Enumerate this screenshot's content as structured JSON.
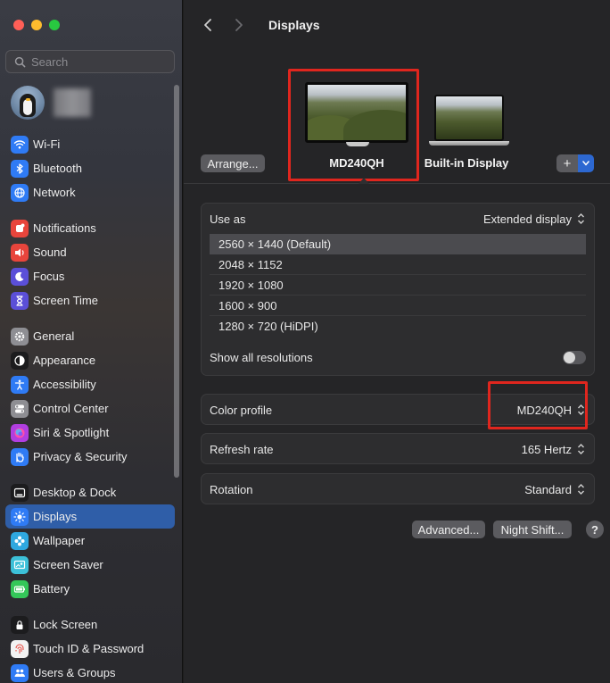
{
  "window": {
    "title": "Displays"
  },
  "sidebar": {
    "search_placeholder": "Search",
    "items": [
      {
        "label": "Wi-Fi",
        "icon": "wifi-icon",
        "color": "#2f7bf5"
      },
      {
        "label": "Bluetooth",
        "icon": "bluetooth-icon",
        "color": "#2f7bf5"
      },
      {
        "label": "Network",
        "icon": "globe-icon",
        "color": "#2f7bf5"
      },
      {
        "label": "Notifications",
        "icon": "bell-icon",
        "color": "#e8453c"
      },
      {
        "label": "Sound",
        "icon": "speaker-icon",
        "color": "#e8453c"
      },
      {
        "label": "Focus",
        "icon": "moon-icon",
        "color": "#5b4fd8"
      },
      {
        "label": "Screen Time",
        "icon": "hourglass-icon",
        "color": "#5b4fd8"
      },
      {
        "label": "General",
        "icon": "gear-icon",
        "color": "#8e8e93"
      },
      {
        "label": "Appearance",
        "icon": "appearance-icon",
        "color": "#1c1c1e"
      },
      {
        "label": "Accessibility",
        "icon": "accessibility-icon",
        "color": "#2f7bf5"
      },
      {
        "label": "Control Center",
        "icon": "switches-icon",
        "color": "#8e8e93"
      },
      {
        "label": "Siri & Spotlight",
        "icon": "siri-icon",
        "color": "#b13ee0"
      },
      {
        "label": "Privacy & Security",
        "icon": "hand-icon",
        "color": "#2f7bf5"
      },
      {
        "label": "Desktop & Dock",
        "icon": "dock-icon",
        "color": "#1c1c1e"
      },
      {
        "label": "Displays",
        "icon": "sun-icon",
        "color": "#2f7bf5"
      },
      {
        "label": "Wallpaper",
        "icon": "flower-icon",
        "color": "#2fa8e0"
      },
      {
        "label": "Screen Saver",
        "icon": "screensaver-icon",
        "color": "#3cc0d8"
      },
      {
        "label": "Battery",
        "icon": "battery-icon",
        "color": "#34c759"
      },
      {
        "label": "Lock Screen",
        "icon": "lock-icon",
        "color": "#1c1c1e"
      },
      {
        "label": "Touch ID & Password",
        "icon": "fingerprint-icon",
        "color": "#f2f2f2"
      },
      {
        "label": "Users & Groups",
        "icon": "users-icon",
        "color": "#2f7bf5"
      }
    ],
    "active": "Displays"
  },
  "main": {
    "title": "Displays",
    "displays": {
      "arrange_label": "Arrange...",
      "primary_name": "MD240QH",
      "secondary_name": "Built-in Display",
      "add_label": "+"
    },
    "use_as": {
      "label": "Use as",
      "value": "Extended display"
    },
    "resolutions": [
      "2560 × 1440 (Default)",
      "2048 × 1152",
      "1920 × 1080",
      "1600 × 900",
      "1280 × 720 (HiDPI)"
    ],
    "selected_resolution": 0,
    "show_all": {
      "label": "Show all resolutions",
      "on": false
    },
    "color_profile": {
      "label": "Color profile",
      "value": "MD240QH"
    },
    "refresh_rate": {
      "label": "Refresh rate",
      "value": "165 Hertz"
    },
    "rotation": {
      "label": "Rotation",
      "value": "Standard"
    },
    "buttons": {
      "advanced": "Advanced...",
      "night_shift": "Night Shift...",
      "help": "?"
    }
  },
  "colors": {
    "accent": "#2f5ea8",
    "highlight": "#e0261e"
  }
}
